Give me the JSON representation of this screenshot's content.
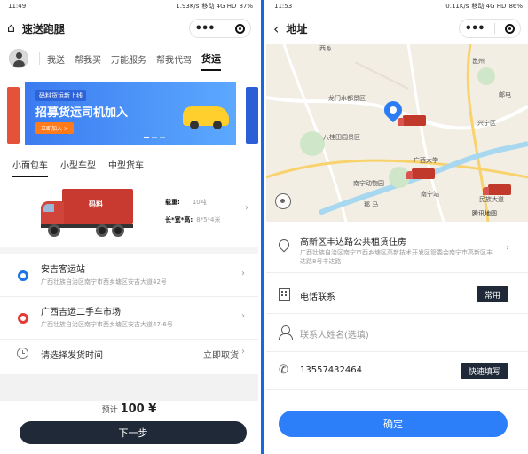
{
  "left": {
    "status": {
      "time": "11:49",
      "speed": "1.93K/s",
      "network": "移动 4G HD",
      "battery": "87%"
    },
    "nav": {
      "title": "速送跑腿"
    },
    "tabs": [
      "我送",
      "帮我买",
      "万能服务",
      "帮我代驾",
      "货运"
    ],
    "banner": {
      "line1": "码料货运新上线",
      "line2": "招募货运司机加入",
      "button": "立即加入 >"
    },
    "vehicle_tabs": [
      "小面包车",
      "小型车型",
      "中型货车"
    ],
    "vehicle": {
      "brand": "码料",
      "load_label": "载重:",
      "load_value": "10吨",
      "size_label": "长*宽*高:",
      "size_value": "8*5*4米"
    },
    "pickup": {
      "name": "安吉客运站",
      "address": "广西壮族自治区南宁市西乡塘区安吉大道42号"
    },
    "dropoff": {
      "name": "广西吉运二手车市场",
      "address": "广西壮族自治区南宁市西乡塘区安吉大道47-6号"
    },
    "time": {
      "label": "请选择发货时间",
      "value": "立即取货"
    },
    "price": {
      "label": "预计",
      "amount": "100 ¥"
    },
    "next_button": "下一步"
  },
  "right": {
    "status": {
      "time": "11:53",
      "speed": "0.11K/s",
      "network": "移动 4G HD",
      "battery": "86%"
    },
    "nav": {
      "title": "地址"
    },
    "map_labels": {
      "a": "西乡",
      "b": "龙门水都景区",
      "c": "八桂田园景区",
      "d": "兴宁区",
      "e": "广西大学",
      "f": "南宁动物园",
      "g": "南宁站",
      "h": "民族大道",
      "i": "邕州",
      "j": "那  马",
      "k": "邮电"
    },
    "map_credit": "腾讯地图",
    "address": {
      "name": "高新区丰达路公共租赁住房",
      "detail": "广西壮族自治区南宁市西乡塘区高新技术开发区管委会南宁市高新区丰达路8号丰达路"
    },
    "contact": {
      "label": "电话联系",
      "button": "常用"
    },
    "name_field": {
      "placeholder": "联系人姓名(选填)"
    },
    "phone": {
      "value": "13557432464",
      "button": "快速填写"
    },
    "confirm_button": "确定"
  }
}
